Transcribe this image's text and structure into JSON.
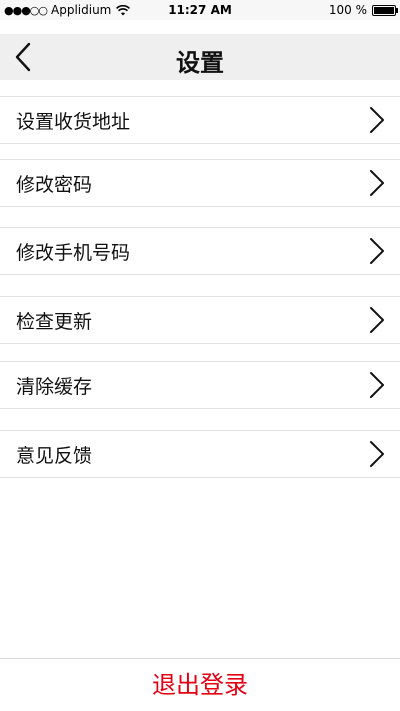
{
  "status_bar": {
    "signal_dots": "●●●○○",
    "carrier": "Applidium",
    "time": "11:27 AM",
    "battery_text": "100 %",
    "battery_level": 1.0
  },
  "nav": {
    "title": "设置",
    "back_icon": "chevron-left-icon"
  },
  "settings": {
    "items": [
      {
        "label": "设置收货地址"
      },
      {
        "label": "修改密码"
      },
      {
        "label": "修改手机号码"
      },
      {
        "label": "检查更新"
      },
      {
        "label": "清除缓存"
      },
      {
        "label": "意见反馈"
      }
    ]
  },
  "footer": {
    "logout_label": "退出登录"
  },
  "colors": {
    "accent_red": "#e60012",
    "navbar_bg": "#efefef",
    "divider": "#e2e2e2"
  }
}
